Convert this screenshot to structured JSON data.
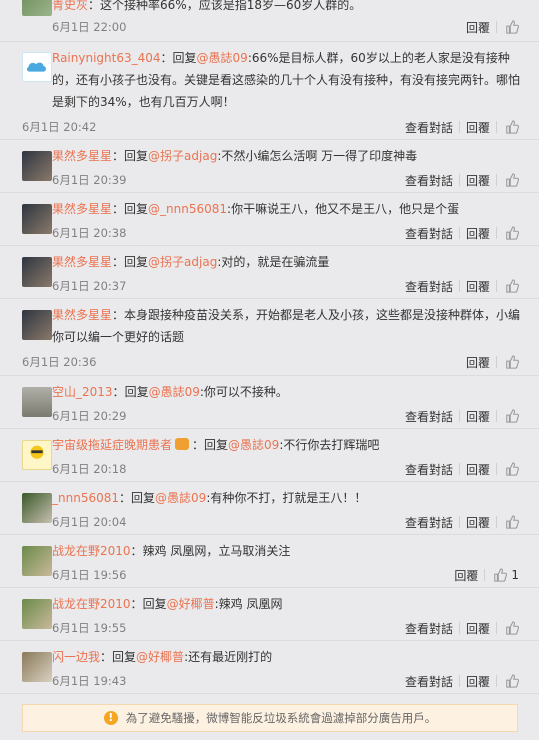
{
  "labels": {
    "view_conversation": "查看對話",
    "reply": "回覆",
    "reply_prefix": "回复",
    "notice": "為了避免騷擾，微博智能反垃圾系統會過濾掉部分廣告用戶。"
  },
  "comments": [
    {
      "user": "青史灰",
      "prefix": "",
      "at": "",
      "body": "：这个接种率66%，应该是指18岁—60岁人群的。",
      "time": "6月1日 22:00",
      "view": false,
      "likes": ""
    },
    {
      "user": "Rainynight63_404",
      "prefix": "：",
      "at": "@愚誌09",
      "body": ":66%是目标人群，60岁以上的老人家是没有接种的，还有小孩子也没有。关键是看这感染的几十个人有没有接种，有没有接完两针。哪怕是剩下的34%，也有几百万人啊！",
      "time": "6月1日 20:42",
      "view": true,
      "likes": ""
    },
    {
      "user": "果然多星星",
      "prefix": "：",
      "at": "@拐子adjag",
      "body": ":不然小编怎么活啊 万一得了印度神毒",
      "time": "6月1日 20:39",
      "view": true,
      "likes": ""
    },
    {
      "user": "果然多星星",
      "prefix": "：",
      "at": "@_nnn56081",
      "body": ":你干嘛说王八，他又不是王八，他只是个蛋",
      "time": "6月1日 20:38",
      "view": true,
      "likes": ""
    },
    {
      "user": "果然多星星",
      "prefix": "：",
      "at": "@拐子adjag",
      "body": ":对的，就是在骗流量",
      "time": "6月1日 20:37",
      "view": true,
      "likes": ""
    },
    {
      "user": "果然多星星",
      "prefix": "",
      "at": "",
      "body": "：本身跟接种疫苗没关系，开始都是老人及小孩，这些都是没接种群体，小编你可以编一个更好的话题",
      "time": "6月1日 20:36",
      "view": false,
      "likes": ""
    },
    {
      "user": "空山_2013",
      "prefix": "：",
      "at": "@愚誌09",
      "body": ":你可以不接种。",
      "time": "6月1日 20:29",
      "view": true,
      "likes": ""
    },
    {
      "user": "宇宙级拖延症晚期患者",
      "prefix": "：",
      "at": "@愚誌09",
      "body": ":不行你去打辉瑞吧",
      "time": "6月1日 20:18",
      "view": true,
      "likes": ""
    },
    {
      "user": "_nnn56081",
      "prefix": "：",
      "at": "@愚誌09",
      "body": ":有种你不打，打就是王八！！",
      "time": "6月1日 20:04",
      "view": true,
      "likes": ""
    },
    {
      "user": "战龙在野2010",
      "prefix": "",
      "at": "",
      "body": "：辣鸡 凤凰网，立马取消关注",
      "time": "6月1日 19:56",
      "view": false,
      "likes": "1"
    },
    {
      "user": "战龙在野2010",
      "prefix": "：",
      "at": "@好椰普",
      "body": ":辣鸡 凤凰网",
      "time": "6月1日 19:55",
      "view": true,
      "likes": ""
    },
    {
      "user": "闪一边我",
      "prefix": "：",
      "at": "@好椰普",
      "body": ":还有最近刚打的",
      "time": "6月1日 19:43",
      "view": true,
      "likes": ""
    }
  ]
}
